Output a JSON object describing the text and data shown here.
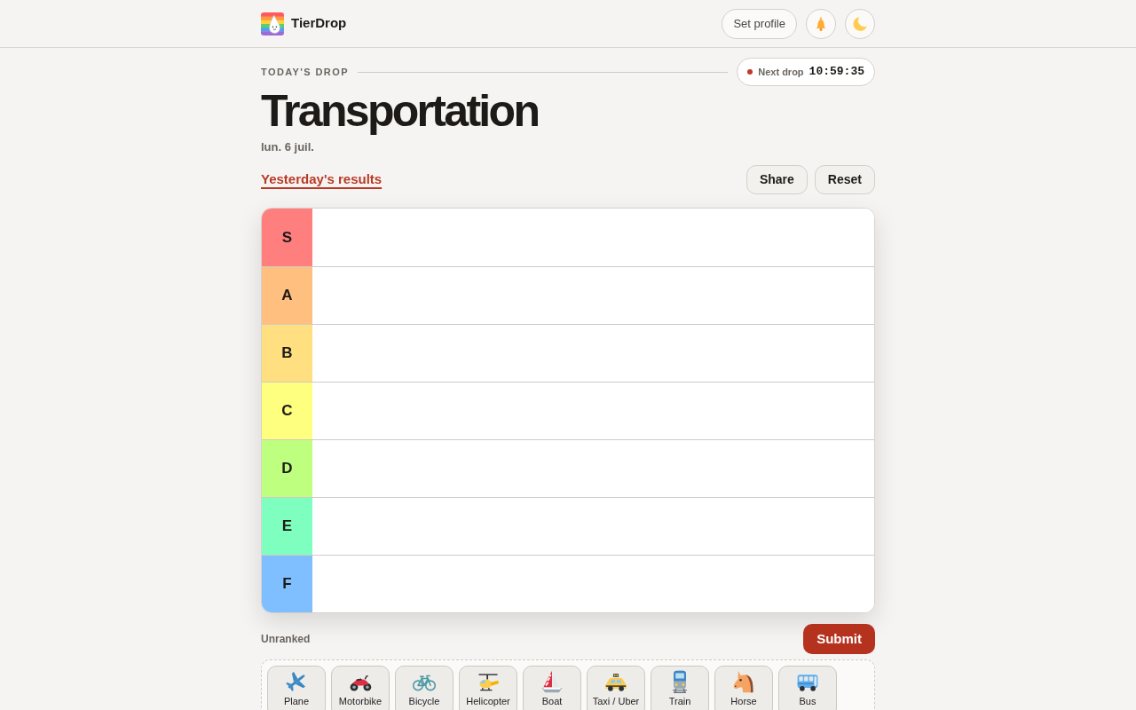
{
  "header": {
    "brand": "TierDrop",
    "profile_button": "Set profile"
  },
  "drop": {
    "eyebrow": "TODAY'S DROP",
    "countdown_label": "Next drop",
    "countdown": "10:59:35",
    "title": "Transportation",
    "date": "lun. 6 juil."
  },
  "results_link": "Yesterday's results",
  "actions": [
    "Share",
    "Reset"
  ],
  "tiers": [
    {
      "label": "S",
      "color": "#ff7f7f"
    },
    {
      "label": "A",
      "color": "#ffbf7f"
    },
    {
      "label": "B",
      "color": "#ffdf7f"
    },
    {
      "label": "C",
      "color": "#ffff7f"
    },
    {
      "label": "D",
      "color": "#bfff7f"
    },
    {
      "label": "E",
      "color": "#7fffbf"
    },
    {
      "label": "F",
      "color": "#7fbfff"
    }
  ],
  "unranked": {
    "label": "Unranked",
    "submit": "Submit",
    "items": [
      {
        "name": "Plane",
        "kind": "plane"
      },
      {
        "name": "Motorbike",
        "kind": "motorbike"
      },
      {
        "name": "Bicycle",
        "kind": "bicycle"
      },
      {
        "name": "Helicopter",
        "kind": "helicopter"
      },
      {
        "name": "Boat",
        "kind": "boat"
      },
      {
        "name": "Taxi / Uber",
        "kind": "taxi"
      },
      {
        "name": "Train",
        "kind": "train"
      },
      {
        "name": "Horse",
        "kind": "horse"
      },
      {
        "name": "Bus",
        "kind": "bus"
      }
    ]
  }
}
